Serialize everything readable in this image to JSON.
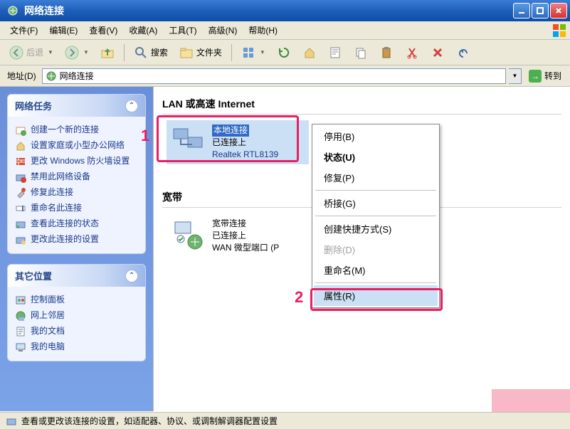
{
  "title": "网络连接",
  "menus": {
    "file": "文件(F)",
    "edit": "编辑(E)",
    "view": "查看(V)",
    "favorites": "收藏(A)",
    "tools": "工具(T)",
    "advanced": "高级(N)",
    "help": "帮助(H)"
  },
  "toolbar": {
    "back": "后退",
    "search": "搜索",
    "folders": "文件夹"
  },
  "address": {
    "label": "地址(D)",
    "value": "网络连接",
    "go": "转到"
  },
  "sidebar": {
    "tasks_header": "网络任务",
    "tasks": [
      "创建一个新的连接",
      "设置家庭或小型办公网络",
      "更改 Windows 防火墙设置",
      "禁用此网络设备",
      "修复此连接",
      "重命名此连接",
      "查看此连接的状态",
      "更改此连接的设置"
    ],
    "other_header": "其它位置",
    "other": [
      "控制面板",
      "网上邻居",
      "我的文档",
      "我的电脑"
    ]
  },
  "content": {
    "lan_header": "LAN 或高速 Internet",
    "lan": {
      "name": "本地连接",
      "status": "已连接上",
      "device": "Realtek RTL8139"
    },
    "broadband_header": "宽带",
    "bb": {
      "name": "宽带连接",
      "status": "已连接上",
      "device": "WAN 微型端口 (P"
    }
  },
  "context_menu": {
    "disable": "停用(B)",
    "status": "状态(U)",
    "repair": "修复(P)",
    "bridge": "桥接(G)",
    "shortcut": "创建快捷方式(S)",
    "delete": "删除(D)",
    "rename": "重命名(M)",
    "properties": "属性(R)"
  },
  "annotations": {
    "one": "1",
    "two": "2"
  },
  "statusbar": "查看或更改该连接的设置，如适配器、协议、或调制解调器配置设置"
}
